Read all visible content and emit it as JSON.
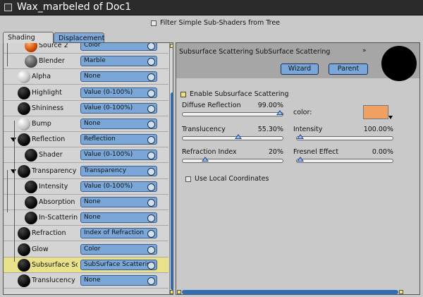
{
  "window": {
    "title": "Wax_marbeled of Doc1"
  },
  "filter": {
    "label": "Filter Simple Sub-Shaders from Tree",
    "checked": false
  },
  "tabs": [
    {
      "label": "Shading",
      "active": true
    },
    {
      "label": "Displacement",
      "active": false
    }
  ],
  "tree": [
    {
      "label": "Source 2",
      "value": "Color",
      "ball": "orange"
    },
    {
      "label": "Blender",
      "value": "Marble",
      "ball": "gray"
    },
    {
      "label": "Alpha",
      "value": "None",
      "ball": "white"
    },
    {
      "label": "Highlight",
      "value": "Value (0-100%)",
      "ball": "black"
    },
    {
      "label": "Shininess",
      "value": "Value (0-100%)",
      "ball": "black"
    },
    {
      "label": "Bump",
      "value": "None",
      "ball": "white"
    },
    {
      "label": "Reflection",
      "value": "Reflection",
      "ball": "black",
      "expanded": true
    },
    {
      "label": "Shader",
      "value": "Value (0-100%)",
      "ball": "black"
    },
    {
      "label": "Transparency",
      "value": "Transparency",
      "ball": "black",
      "expanded": true
    },
    {
      "label": "Intensity",
      "value": "Value (0-100%)",
      "ball": "black"
    },
    {
      "label": "Absorption",
      "value": "None",
      "ball": "black"
    },
    {
      "label": "In-Scattering",
      "value": "None",
      "ball": "black"
    },
    {
      "label": "Refraction",
      "value": "Index of Refraction",
      "ball": "black"
    },
    {
      "label": "Glow",
      "value": "Color",
      "ball": "black"
    },
    {
      "label": "Subsurface Sc",
      "value": "SubSurface Scattering",
      "ball": "black",
      "selected": true
    },
    {
      "label": "Translucency",
      "value": "None",
      "ball": "black"
    }
  ],
  "panel": {
    "title": "Subsurface Scattering SubSurface Scattering",
    "collapse_glyph": "»",
    "wizard_label": "Wizard",
    "parent_label": "Parent",
    "enable_label": "Enable Subsurface Scattering",
    "enable_checked": true,
    "color_label": "color:",
    "color_value": "#f0a060",
    "use_local_label": "Use Local Coordinates",
    "use_local_checked": false,
    "params": [
      {
        "label": "Diffuse Reflection",
        "value": "99.00%",
        "fraction": 0.99
      },
      {
        "label": "Translucency",
        "value": "55.30%",
        "fraction": 0.553
      },
      {
        "label": "Intensity",
        "value": "100.00%",
        "fraction": 0.0
      },
      {
        "label": "Refraction Index",
        "value": "20%",
        "fraction": 0.2
      },
      {
        "label": "Fresnel Effect",
        "value": "0.00%",
        "fraction": 0.0
      }
    ]
  }
}
